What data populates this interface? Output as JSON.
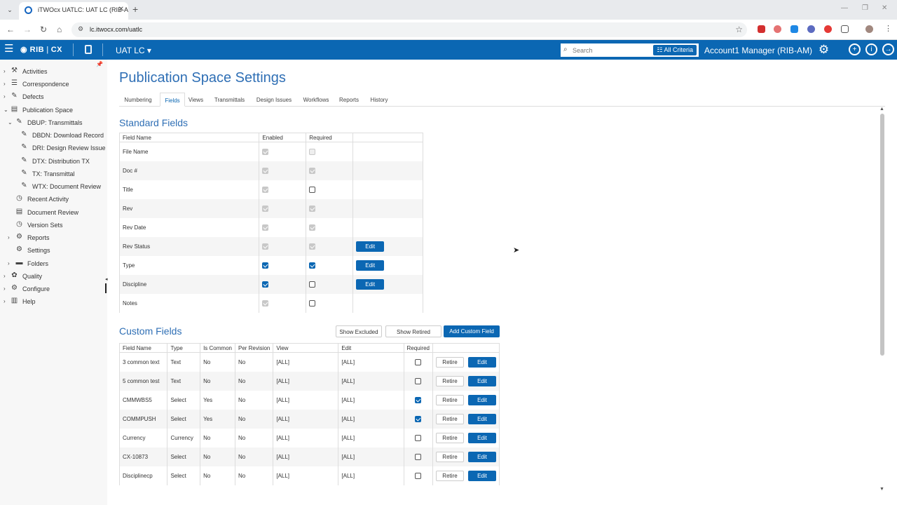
{
  "browser": {
    "tab_title": "iTWOcx UATLC: UAT LC (RIB-AM)",
    "url": "lc.itwocx.com/uatlc"
  },
  "appbar": {
    "logo_brand": "RIB",
    "logo_product": "CX",
    "project": "UAT LC",
    "search_placeholder": "Search",
    "criteria_label": "All Criteria",
    "user": "Account1 Manager (RIB-AM)"
  },
  "sidebar": {
    "items": [
      {
        "label": "Activities"
      },
      {
        "label": "Correspondence"
      },
      {
        "label": "Defects"
      },
      {
        "label": "Publication Space"
      },
      {
        "label": "DBUP: Transmittals"
      },
      {
        "label": "DBDN: Download Record"
      },
      {
        "label": "DRI: Design Review Issue"
      },
      {
        "label": "DTX: Distribution TX"
      },
      {
        "label": "TX: Transmittal"
      },
      {
        "label": "WTX: Document Review"
      },
      {
        "label": "Recent Activity"
      },
      {
        "label": "Document Review"
      },
      {
        "label": "Version Sets"
      },
      {
        "label": "Reports"
      },
      {
        "label": "Settings"
      },
      {
        "label": "Folders"
      },
      {
        "label": "Quality"
      },
      {
        "label": "Configure"
      },
      {
        "label": "Help"
      }
    ]
  },
  "page": {
    "title": "Publication Space Settings",
    "tabs": [
      "Numbering",
      "Fields",
      "Views",
      "Transmittals",
      "Design Issues",
      "Workflows",
      "Reports",
      "History"
    ],
    "active_tab": "Fields"
  },
  "standard_fields": {
    "title": "Standard Fields",
    "headers": [
      "Field Name",
      "Enabled",
      "Required",
      ""
    ],
    "edit_label": "Edit",
    "rows": [
      {
        "name": "File Name",
        "enabled": true,
        "enabled_disabled": true,
        "required": false,
        "required_disabled": true,
        "edit": false
      },
      {
        "name": "Doc #",
        "enabled": true,
        "enabled_disabled": true,
        "required": true,
        "required_disabled": true,
        "edit": false
      },
      {
        "name": "Title",
        "enabled": true,
        "enabled_disabled": true,
        "required": false,
        "required_disabled": false,
        "edit": false
      },
      {
        "name": "Rev",
        "enabled": true,
        "enabled_disabled": true,
        "required": true,
        "required_disabled": true,
        "edit": false
      },
      {
        "name": "Rev Date",
        "enabled": true,
        "enabled_disabled": true,
        "required": true,
        "required_disabled": true,
        "edit": false
      },
      {
        "name": "Rev Status",
        "enabled": true,
        "enabled_disabled": true,
        "required": true,
        "required_disabled": true,
        "edit": true
      },
      {
        "name": "Type",
        "enabled": true,
        "enabled_disabled": false,
        "required": true,
        "required_disabled": false,
        "edit": true
      },
      {
        "name": "Discipline",
        "enabled": true,
        "enabled_disabled": false,
        "required": false,
        "required_disabled": false,
        "edit": true
      },
      {
        "name": "Notes",
        "enabled": true,
        "enabled_disabled": true,
        "required": false,
        "required_disabled": false,
        "edit": false
      }
    ]
  },
  "custom_fields": {
    "title": "Custom Fields",
    "show_excluded": "Show Excluded",
    "show_retired": "Show Retired",
    "add_custom": "Add Custom Field",
    "headers": [
      "Field Name",
      "Type",
      "Is Common",
      "Per Revision",
      "View",
      "Edit",
      "Required",
      ""
    ],
    "retire_label": "Retire",
    "edit_label": "Edit",
    "rows": [
      {
        "name": "3 common text",
        "type": "Text",
        "common": "No",
        "per_rev": "No",
        "view": "[ALL]",
        "edit": "[ALL]",
        "required": false
      },
      {
        "name": "5 common test",
        "type": "Text",
        "common": "No",
        "per_rev": "No",
        "view": "[ALL]",
        "edit": "[ALL]",
        "required": false
      },
      {
        "name": "CMMWBS5",
        "type": "Select",
        "common": "Yes",
        "per_rev": "No",
        "view": "[ALL]",
        "edit": "[ALL]",
        "required": true
      },
      {
        "name": "COMMPUSH",
        "type": "Select",
        "common": "Yes",
        "per_rev": "No",
        "view": "[ALL]",
        "edit": "[ALL]",
        "required": true
      },
      {
        "name": "Currency",
        "type": "Currency",
        "common": "No",
        "per_rev": "No",
        "view": "[ALL]",
        "edit": "[ALL]",
        "required": false
      },
      {
        "name": "CX-10873",
        "type": "Select",
        "common": "No",
        "per_rev": "No",
        "view": "[ALL]",
        "edit": "[ALL]",
        "required": false
      },
      {
        "name": "Disciplinecp",
        "type": "Select",
        "common": "No",
        "per_rev": "No",
        "view": "[ALL]",
        "edit": "[ALL]",
        "required": false
      }
    ]
  }
}
